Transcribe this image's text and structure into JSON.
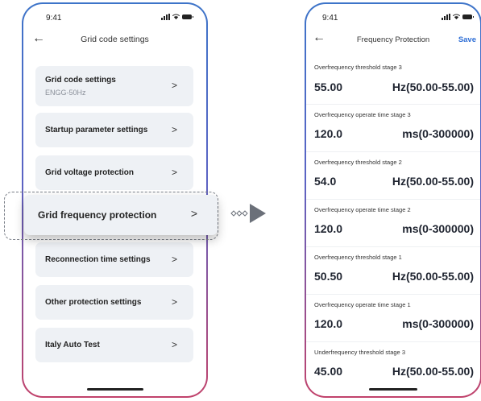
{
  "left_screen": {
    "status_time": "9:41",
    "title": "Grid code settings",
    "menu": [
      {
        "label": "Grid code settings",
        "sub": "ENGG-50Hz"
      },
      {
        "label": "Startup parameter settings"
      },
      {
        "label": "Grid voltage protection"
      },
      {
        "label": "Grid frequency protection"
      },
      {
        "label": "Reconnection time settings"
      },
      {
        "label": "Other protection settings"
      },
      {
        "label": "Italy Auto Test"
      }
    ]
  },
  "right_screen": {
    "status_time": "9:41",
    "title": "Frequency Protection",
    "save_label": "Save",
    "fields": [
      {
        "label": "Overfrequency threshold stage 3",
        "value": "55.00",
        "unit": "Hz(50.00-55.00)"
      },
      {
        "label": "Overfrequency operate time stage 3",
        "value": "120.0",
        "unit": "ms(0-300000)"
      },
      {
        "label": "Overfrequency threshold stage 2",
        "value": "54.0",
        "unit": "Hz(50.00-55.00)"
      },
      {
        "label": "Overfrequency operate time stage 2",
        "value": "120.0",
        "unit": "ms(0-300000)"
      },
      {
        "label": "Overfrequency threshold stage 1",
        "value": "50.50",
        "unit": "Hz(50.00-55.00)"
      },
      {
        "label": "Overfrequency operate time stage 1",
        "value": "120.0",
        "unit": "ms(0-300000)"
      },
      {
        "label": "Underfrequency threshold stage 3",
        "value": "45.00",
        "unit": "Hz(50.00-55.00)"
      }
    ]
  },
  "icons": {
    "back": "arrow-left-icon",
    "chevron": "chevron-right-icon",
    "signal": "signal-icon",
    "wifi": "wifi-icon",
    "battery": "battery-icon",
    "connector": "arrow-right-icon"
  },
  "colors": {
    "accent": "#2f6fd6",
    "card_bg": "#eef1f5",
    "frame_top": "#3d74c9",
    "frame_bottom": "#c1426b"
  }
}
